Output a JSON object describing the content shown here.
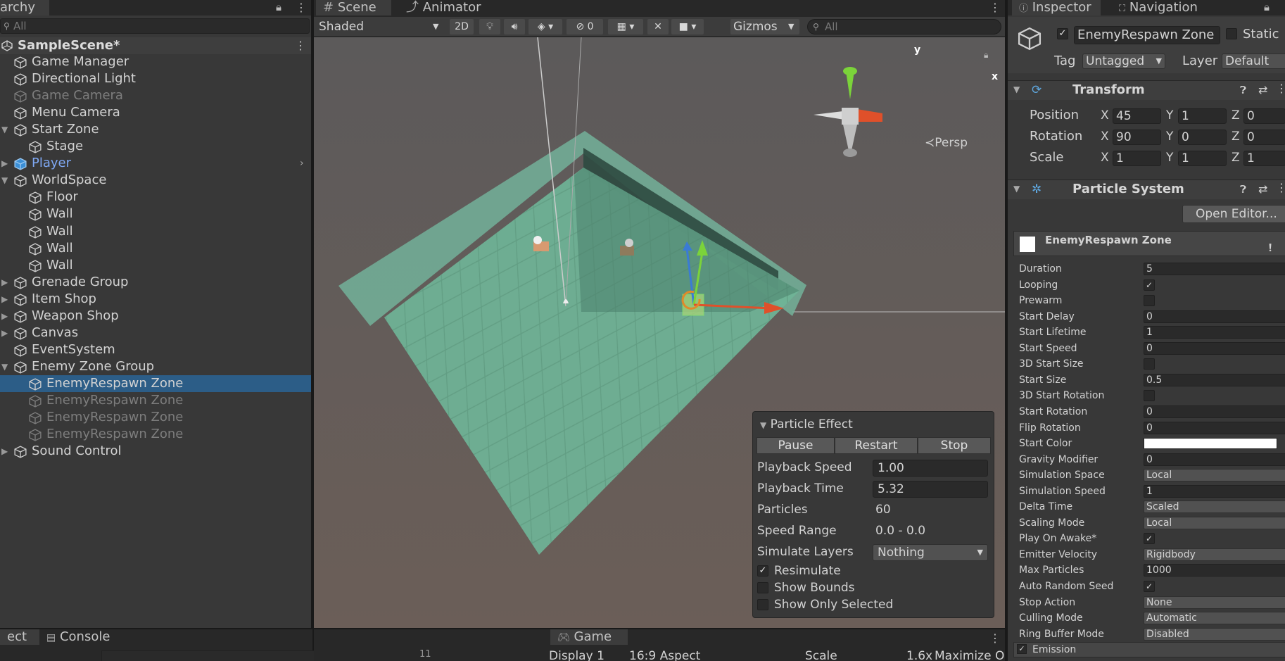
{
  "hierarchy": {
    "tab_label": "archy",
    "search_placeholder": "All",
    "scene_name": "SampleScene*",
    "items": [
      {
        "label": "Game Manager"
      },
      {
        "label": "Directional Light"
      },
      {
        "label": "Game Camera"
      },
      {
        "label": "Menu Camera"
      },
      {
        "label": "Start Zone"
      },
      {
        "label": "Stage"
      },
      {
        "label": "Player"
      },
      {
        "label": "WorldSpace"
      },
      {
        "label": "Floor"
      },
      {
        "label": "Wall"
      },
      {
        "label": "Wall"
      },
      {
        "label": "Wall"
      },
      {
        "label": "Wall"
      },
      {
        "label": "Grenade Group"
      },
      {
        "label": "Item Shop"
      },
      {
        "label": "Weapon Shop"
      },
      {
        "label": "Canvas"
      },
      {
        "label": "EventSystem"
      },
      {
        "label": "Enemy Zone Group"
      },
      {
        "label": "EnemyRespawn Zone"
      },
      {
        "label": "EnemyRespawn Zone"
      },
      {
        "label": "EnemyRespawn Zone"
      },
      {
        "label": "EnemyRespawn Zone"
      },
      {
        "label": "Sound Control"
      }
    ]
  },
  "scene": {
    "tab_scene": "Scene",
    "tab_animator": "Animator",
    "shading_mode": "Shaded",
    "mode_2d": "2D",
    "hidden_count": "0",
    "gizmos_label": "Gizmos",
    "search_placeholder": "All",
    "persp_label": "Persp",
    "axis_x": "x",
    "axis_y": "y"
  },
  "particle_effect": {
    "title": "Particle Effect",
    "pause": "Pause",
    "restart": "Restart",
    "stop": "Stop",
    "playback_speed_label": "Playback Speed",
    "playback_speed": "1.00",
    "playback_time_label": "Playback Time",
    "playback_time": "5.32",
    "particles_label": "Particles",
    "particles": "60",
    "speed_range_label": "Speed Range",
    "speed_range": "0.0 - 0.0",
    "simulate_layers_label": "Simulate Layers",
    "simulate_layers": "Nothing",
    "resimulate": "Resimulate",
    "show_bounds": "Show Bounds",
    "show_only_selected": "Show Only Selected"
  },
  "inspector": {
    "tab_inspector": "Inspector",
    "tab_navigation": "Navigation",
    "object_name": "EnemyRespawn Zone",
    "static_label": "Static",
    "tag_label": "Tag",
    "tag_value": "Untagged",
    "layer_label": "Layer",
    "layer_value": "Default",
    "transform_title": "Transform",
    "position_label": "Position",
    "rotation_label": "Rotation",
    "scale_label": "Scale",
    "axis_x": "X",
    "axis_y": "Y",
    "axis_z": "Z",
    "position": {
      "x": "45",
      "y": "1",
      "z": "0"
    },
    "rotation": {
      "x": "90",
      "y": "0",
      "z": "0"
    },
    "scale": {
      "x": "1",
      "y": "1",
      "z": "1"
    },
    "particle_system_title": "Particle System",
    "open_editor": "Open Editor...",
    "module_name": "EnemyRespawn Zone",
    "properties": [
      {
        "label": "Duration",
        "value": "5",
        "kind": "field"
      },
      {
        "label": "Looping",
        "value": "✓",
        "kind": "check"
      },
      {
        "label": "Prewarm",
        "value": "",
        "kind": "check"
      },
      {
        "label": "Start Delay",
        "value": "0",
        "kind": "field"
      },
      {
        "label": "Start Lifetime",
        "value": "1",
        "kind": "field"
      },
      {
        "label": "Start Speed",
        "value": "0",
        "kind": "field"
      },
      {
        "label": "3D Start Size",
        "value": "",
        "kind": "check"
      },
      {
        "label": "Start Size",
        "value": "0.5",
        "kind": "field"
      },
      {
        "label": "3D Start Rotation",
        "value": "",
        "kind": "check"
      },
      {
        "label": "Start Rotation",
        "value": "0",
        "kind": "field"
      },
      {
        "label": "Flip Rotation",
        "value": "0",
        "kind": "field"
      },
      {
        "label": "Start Color",
        "value": "",
        "kind": "color"
      },
      {
        "label": "Gravity Modifier",
        "value": "0",
        "kind": "field"
      },
      {
        "label": "Simulation Space",
        "value": "Local",
        "kind": "drop"
      },
      {
        "label": "Simulation Speed",
        "value": "1",
        "kind": "field"
      },
      {
        "label": "Delta Time",
        "value": "Scaled",
        "kind": "drop"
      },
      {
        "label": "Scaling Mode",
        "value": "Local",
        "kind": "drop"
      },
      {
        "label": "Play On Awake*",
        "value": "✓",
        "kind": "check"
      },
      {
        "label": "Emitter Velocity",
        "value": "Rigidbody",
        "kind": "drop"
      },
      {
        "label": "Max Particles",
        "value": "1000",
        "kind": "field"
      },
      {
        "label": "Auto Random Seed",
        "value": "✓",
        "kind": "check"
      },
      {
        "label": "Stop Action",
        "value": "None",
        "kind": "drop"
      },
      {
        "label": "Culling Mode",
        "value": "Automatic",
        "kind": "drop"
      },
      {
        "label": "Ring Buffer Mode",
        "value": "Disabled",
        "kind": "drop"
      }
    ],
    "emission_label": "Emission"
  },
  "bottom": {
    "tab_project": "ect",
    "tab_console": "Console",
    "tab_game": "Game",
    "display": "Display 1",
    "aspect": "16:9 Aspect",
    "scale_label": "Scale",
    "scale_value": "1.6x",
    "maximize": "Maximize O",
    "layer_count": "11"
  }
}
